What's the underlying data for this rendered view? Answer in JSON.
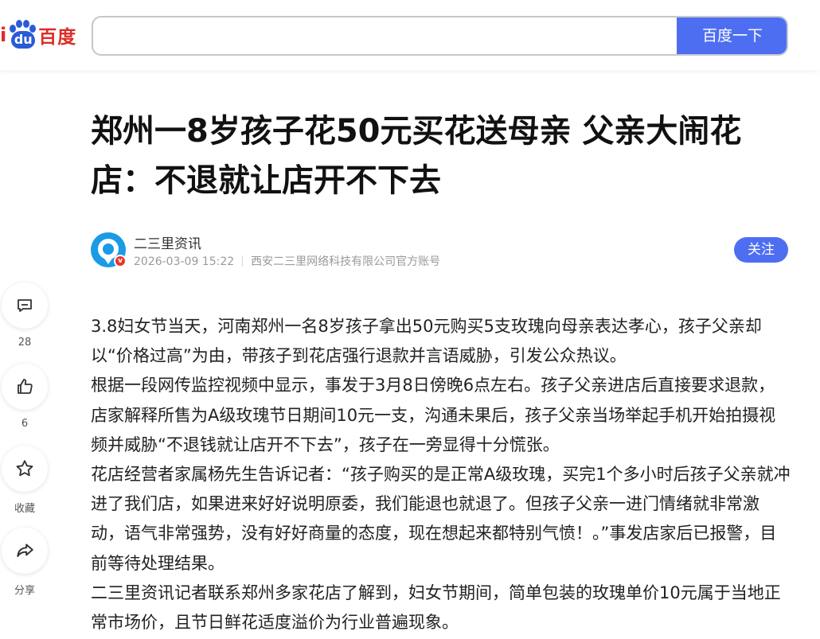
{
  "header": {
    "logo_brand": "百度",
    "logo_du": "du",
    "search_value": "",
    "search_button": "百度一下"
  },
  "article": {
    "title": "郑州一8岁孩子花50元买花送母亲 父亲大闹花店：不退就让店开不下去",
    "author": {
      "name": "二三里资讯",
      "datetime": "2026-03-09 15:22",
      "org": "西安二三里网络科技有限公司官方账号",
      "follow_label": "关注"
    },
    "paragraphs": [
      "3.8妇女节当天，河南郑州一名8岁孩子拿出50元购买5支玫瑰向母亲表达孝心，孩子父亲却以“价格过高”为由，带孩子到花店强行退款并言语威胁，引发公众热议。",
      "根据一段网传监控视频中显示，事发于3月8日傍晚6点左右。孩子父亲进店后直接要求退款，店家解释所售为A级玫瑰节日期间10元一支，沟通未果后，孩子父亲当场举起手机开始拍摄视频并威胁“不退钱就让店开不下去”，孩子在一旁显得十分慌张。",
      "花店经营者家属杨先生告诉记者：“孩子购买的是正常A级玫瑰，买完1个多小时后孩子父亲就冲进了我们店，如果进来好好说明原委，我们能退也就退了。但孩子父亲一进门情绪就非常激动，语气非常强势，没有好好商量的态度，现在想起来都特别气愤！。”事发店家后已报警，目前等待处理结果。",
      "二三里资讯记者联系郑州多家花店了解到，妇女节期间，简单包装的玫瑰单价10元属于当地正常市场价，且节日鲜花适度溢价为行业普遍现象。"
    ]
  },
  "sidebar": {
    "comment_count": "28",
    "like_count": "6",
    "favorite_label": "收藏",
    "share_label": "分享"
  },
  "colors": {
    "accent": "#4e6ef2",
    "logo_red": "#de2b26",
    "logo_blue": "#2a5bd7"
  },
  "icons": [
    "baidu-paw-icon",
    "comment-icon",
    "like-icon",
    "star-icon",
    "share-icon",
    "verified-icon"
  ]
}
